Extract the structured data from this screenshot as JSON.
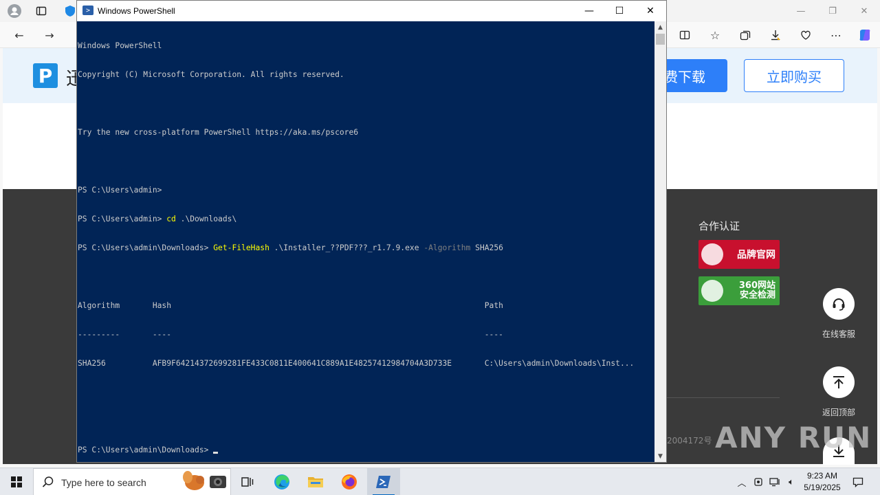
{
  "browser": {
    "nav_back_icon": "arrow-left-icon",
    "nav_forward_icon": "arrow-right-icon",
    "toolbar_icons": [
      "split-screen-icon",
      "favorites-icon",
      "collections-icon",
      "downloads-icon",
      "extensions-icon",
      "more-icon",
      "copilot-icon"
    ]
  },
  "site": {
    "logo_letter": "P",
    "logo_partial_char": "迅",
    "download_button": "费下载",
    "buy_button": "立即购买",
    "partner_title": "合作认证",
    "badge_brand": "品牌官网",
    "badge_360_line1": "360网站",
    "badge_360_line2": "安全检测",
    "service_label": "在线客服",
    "back_top_label": "返回顶部",
    "icp_fragment": "2004172号",
    "watermark": "ANY RUN",
    "accent_color": "#2d7ff9"
  },
  "powershell": {
    "window_title": "Windows PowerShell",
    "lines": [
      "Windows PowerShell",
      "Copyright (C) Microsoft Corporation. All rights reserved.",
      "",
      "Try the new cross-platform PowerShell https://aka.ms/pscore6",
      "",
      "PS C:\\Users\\admin>",
      "PS C:\\Users\\admin> ",
      "PS C:\\Users\\admin\\Downloads> ",
      "",
      "Algorithm       Hash                                                                   Path",
      "---------       ----                                                                   ----",
      "SHA256          AFB9F64214372699281FE433C0811E400641C889A1E48257412984704A3D733E       C:\\Users\\admin\\Downloads\\Inst...",
      "",
      "",
      "PS C:\\Users\\admin\\Downloads> "
    ],
    "cmd_cd": "cd",
    "cmd_cd_arg": " .\\Downloads\\",
    "cmd_hash": "Get-FileHash",
    "cmd_hash_arg": " .\\Installer_??PDF???_r1.7.9.exe ",
    "cmd_hash_param": "-Algorithm",
    "cmd_hash_value": " SHA256",
    "background_color": "#012456"
  },
  "taskbar": {
    "search_placeholder": "Type here to search",
    "time": "9:23 AM",
    "date": "5/19/2025",
    "apps": [
      "task-view-icon",
      "edge-icon",
      "file-explorer-icon",
      "firefox-icon",
      "powershell-icon"
    ]
  }
}
